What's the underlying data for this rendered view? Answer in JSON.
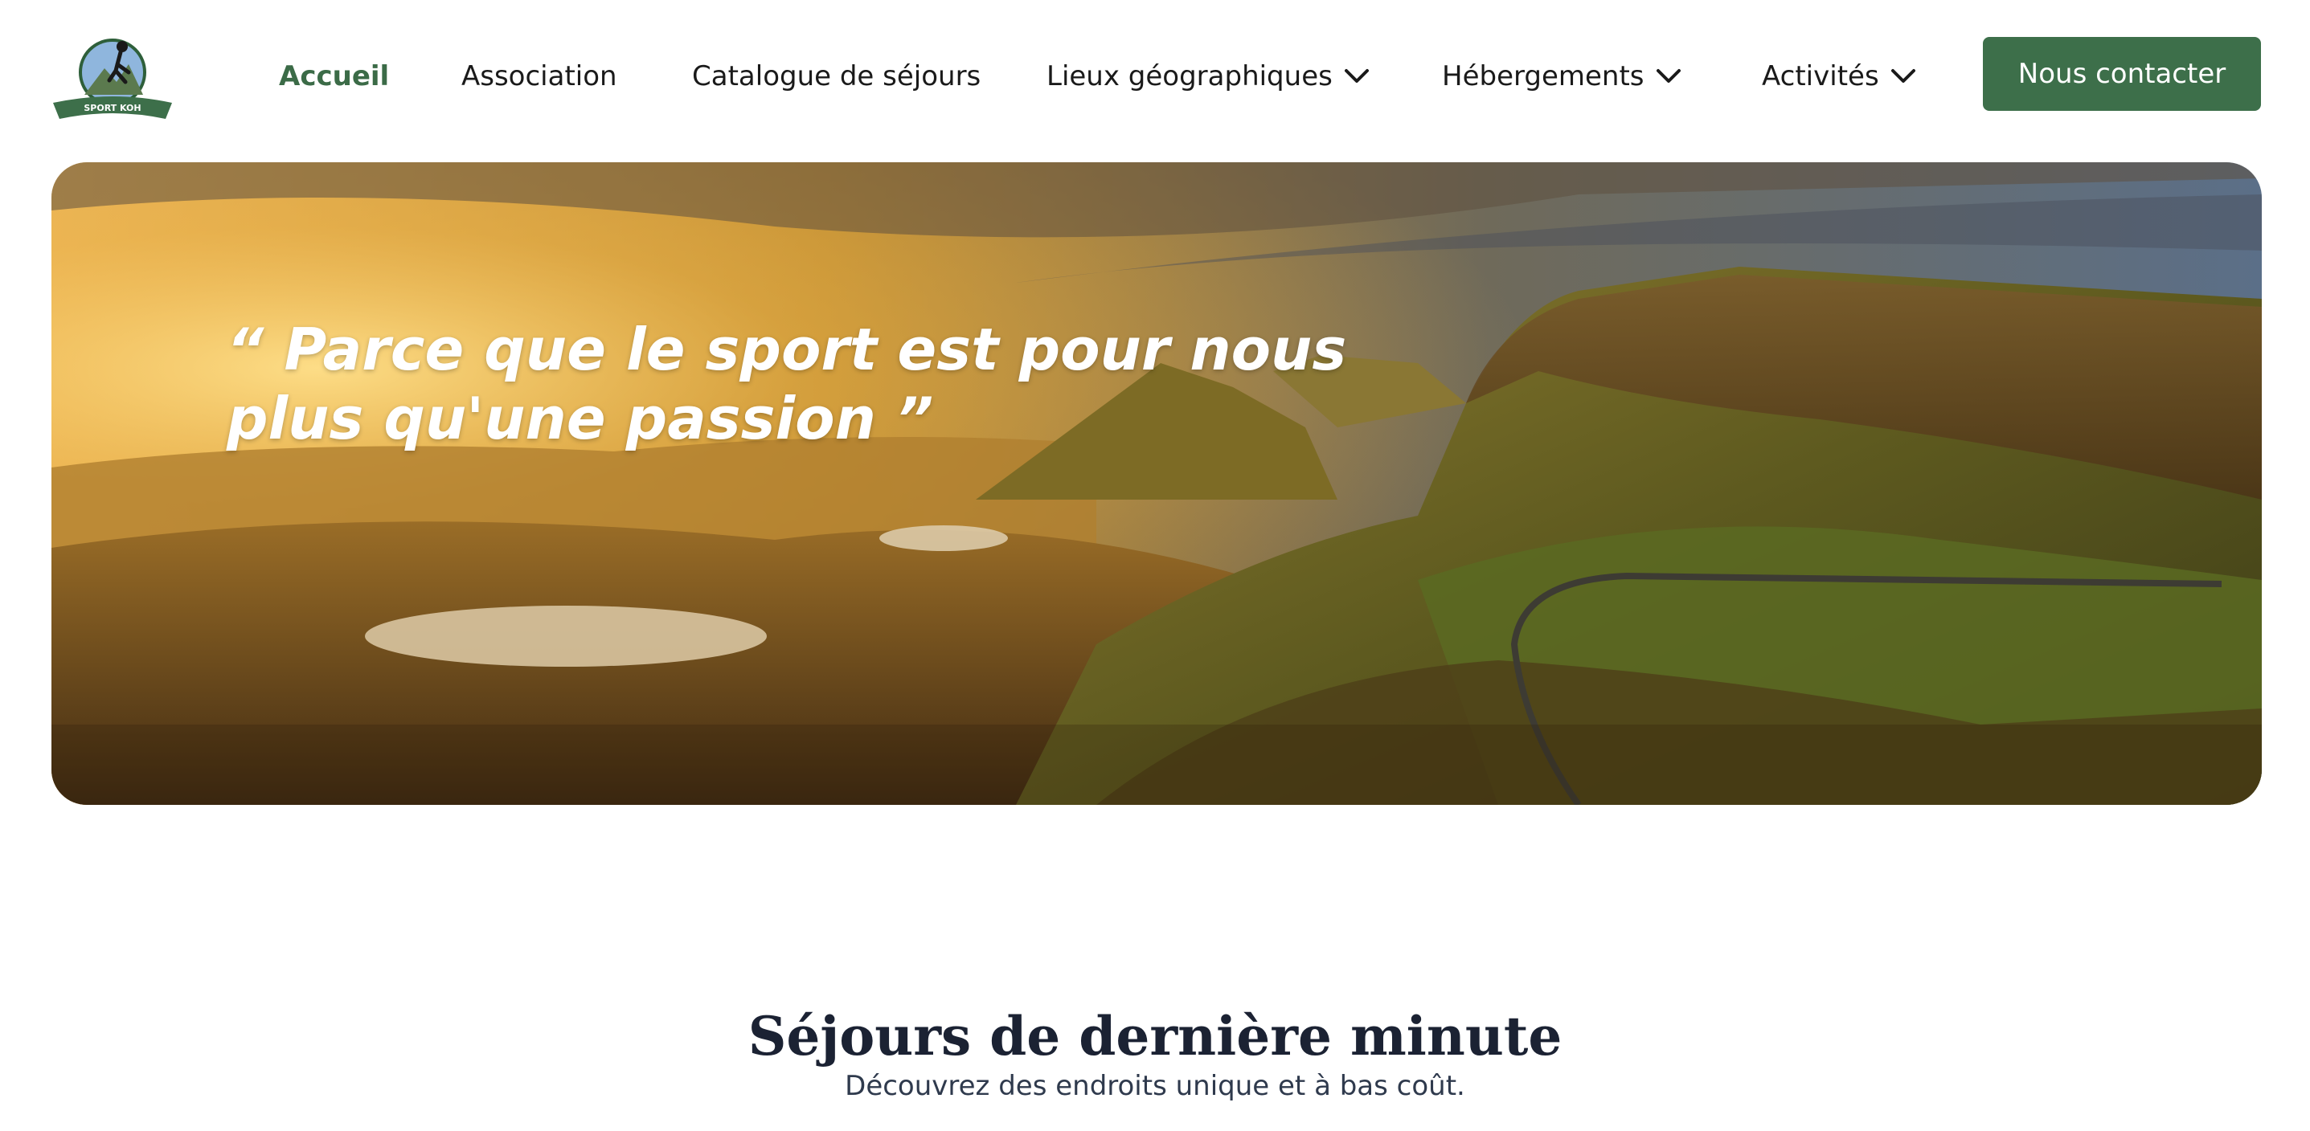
{
  "header": {
    "logo_text": "SPORT KOH",
    "nav": [
      {
        "label": "Accueil",
        "active": true,
        "dropdown": false
      },
      {
        "label": "Association",
        "active": false,
        "dropdown": false
      },
      {
        "label": "Catalogue de séjours",
        "active": false,
        "dropdown": false
      },
      {
        "label": "Lieux géographiques",
        "active": false,
        "dropdown": true
      },
      {
        "label": "Hébergements",
        "active": false,
        "dropdown": true
      },
      {
        "label": "Activités",
        "active": false,
        "dropdown": true
      }
    ],
    "cta_label": "Nous contacter"
  },
  "hero": {
    "quote_line1": "“ Parce que le sport est pour nous",
    "quote_line2": "plus qu'une passion ”"
  },
  "section": {
    "title": "Séjours de dernière minute",
    "subtitle": "Découvrez des endroits unique et à bas coût."
  },
  "colors": {
    "brand_green": "#3d6f4a",
    "active_nav": "#3b6b47",
    "title_dark": "#1b2233"
  },
  "icons": [
    "logo-emblem",
    "chevron-down-icon"
  ]
}
